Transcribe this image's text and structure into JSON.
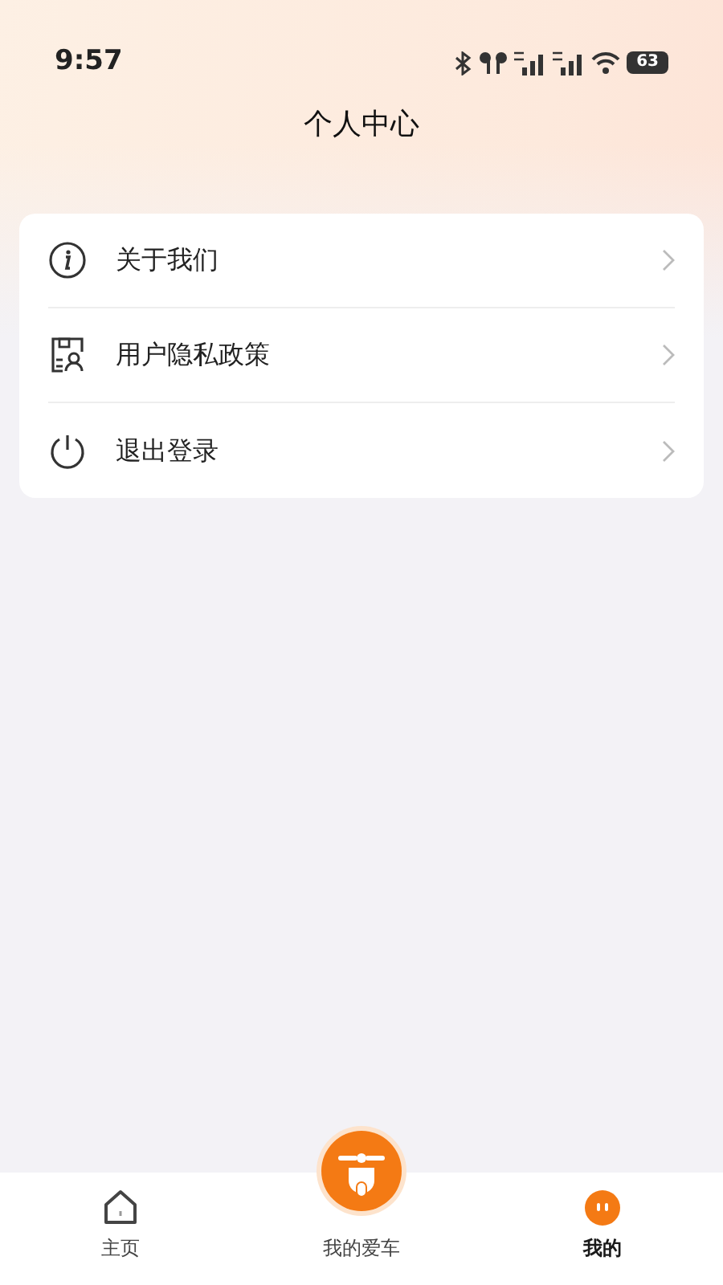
{
  "status_bar": {
    "time": "9:57",
    "battery": "63"
  },
  "title": "个人中心",
  "menu": [
    {
      "kind": "info",
      "label": "关于我们"
    },
    {
      "kind": "privacy",
      "label": "用户隐私政策"
    },
    {
      "kind": "power",
      "label": "退出登录"
    }
  ],
  "tabs": [
    {
      "kind": "home",
      "label": "主页",
      "selected": false
    },
    {
      "kind": "scooter",
      "label": "我的爱车",
      "selected": false
    },
    {
      "kind": "profile",
      "label": "我的",
      "selected": true
    }
  ]
}
